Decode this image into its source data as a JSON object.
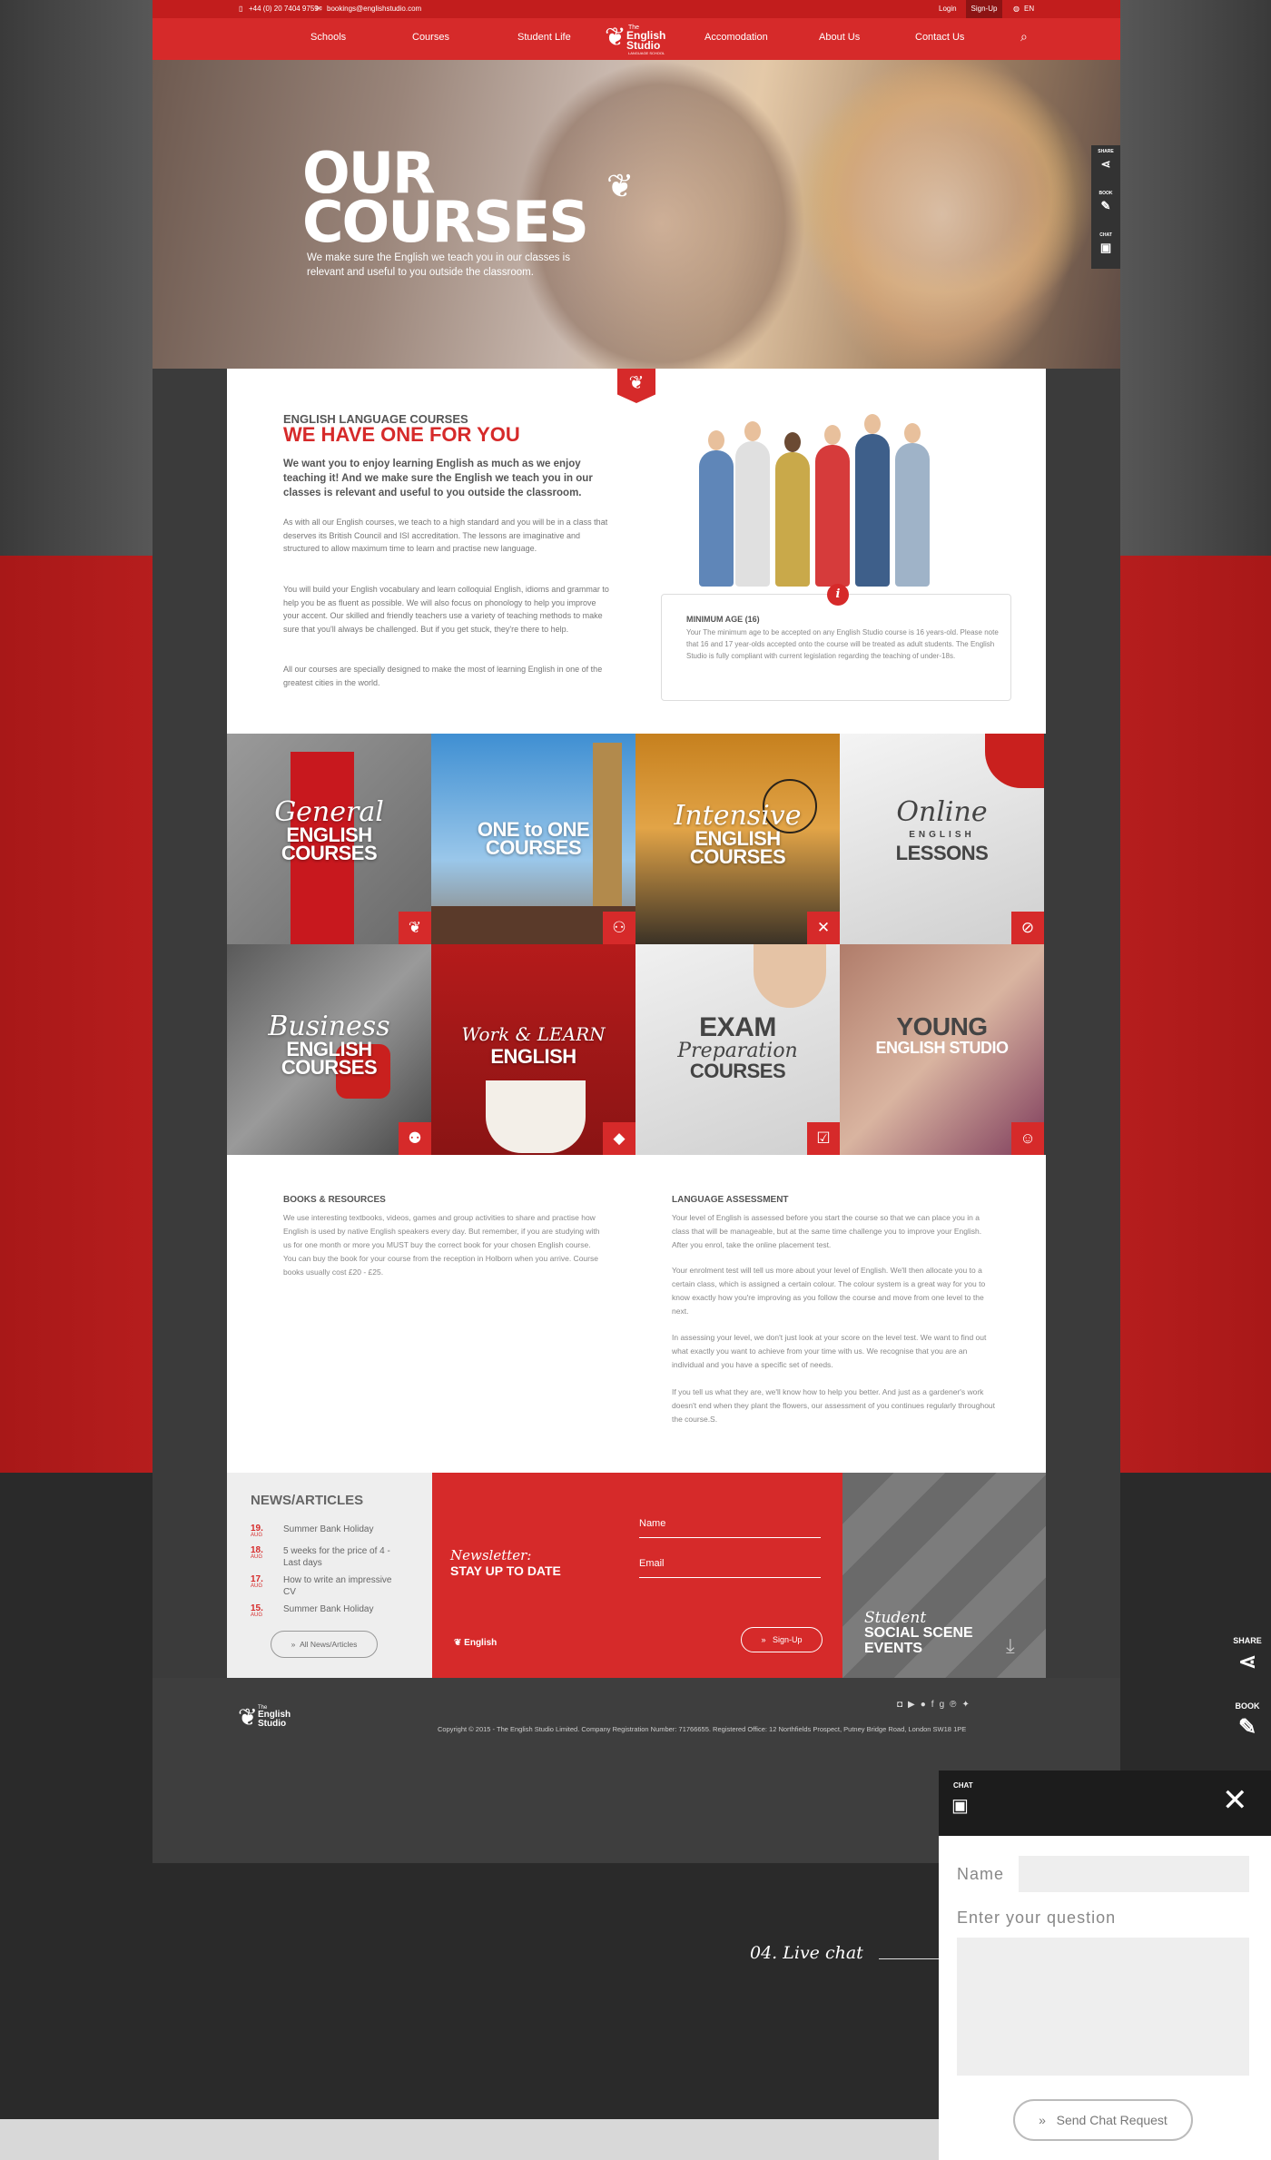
{
  "topbar": {
    "phone": "+44 (0) 20 7404 9759",
    "email": "bookings@englishstudio.com",
    "login": "Login",
    "signup": "Sign-Up",
    "language": "EN"
  },
  "brand": {
    "line1": "The",
    "line2a": "English",
    "line2b": "Studio",
    "line3": "LANGUAGE SCHOOL"
  },
  "nav": {
    "items": [
      "Schools",
      "Courses",
      "Student Life",
      "Accomodation",
      "About Us",
      "Contact Us"
    ]
  },
  "hero": {
    "title_line1": "OUR",
    "title_line2": "COURSES",
    "tagline": "We make sure the English we teach you in our classes is relevant and useful to you outside the classroom."
  },
  "sidetabs": {
    "share": "SHARE",
    "book": "BOOK",
    "chat": "CHAT"
  },
  "intro": {
    "eyebrow": "ENGLISH LANGUAGE COURSES",
    "headline": "WE HAVE ONE FOR YOU",
    "lead": "We want you to enjoy learning English as much as we enjoy teaching it! And we make sure the English we teach you in our classes is relevant and useful to you outside the classroom.",
    "paragraphs": [
      "As with all our English courses, we teach to a high standard and you will be in a class that deserves its British Council and ISI accreditation. The lessons are imaginative and structured to allow maximum time to learn and practise new language.",
      "You will build your English vocabulary and learn colloquial English, idioms and grammar to help you be as fluent as possible. We will also focus on phonology to help you improve your accent. Our skilled and friendly teachers use a variety of teaching methods to make sure that you'll always be challenged. But if you get stuck, they're there to help.",
      "All our courses are specially designed to make the most of learning English in one of the greatest cities in the world."
    ],
    "min_age_title": "MINIMUM AGE (16)",
    "min_age_body": "Your The minimum age to be accepted on any English Studio course is 16 years-old. Please note that 16 and 17 year-olds accepted onto the course will be treated as adult students. The English Studio is fully compliant with current legislation regarding the teaching of under-18s."
  },
  "courses": [
    {
      "script": "General",
      "big1": "ENGLISH",
      "big2": "COURSES"
    },
    {
      "script": "",
      "big1": "ONE to ONE",
      "big2": "COURSES"
    },
    {
      "script": "Intensive",
      "big1": "ENGLISH",
      "big2": "COURSES"
    },
    {
      "script": "Online",
      "big1": "ENGLISH",
      "big2": "LESSONS"
    },
    {
      "script": "Business",
      "big1": "ENGLISH",
      "big2": "COURSES"
    },
    {
      "script": "Work & LEARN",
      "big1": "ENGLISH",
      "big2": ""
    },
    {
      "script": "Preparation",
      "big1": "EXAM",
      "big2": "COURSES"
    },
    {
      "script": "",
      "big1": "YOUNG",
      "big2": "ENGLISH STUDIO"
    }
  ],
  "resources": {
    "books_title": "BOOKS & RESOURCES",
    "books_body": "We use interesting textbooks, videos, games and group activities to share and practise how English is used by native English speakers every day. But remember, if you are studying with us for one month or more you MUST buy the correct book for your chosen English course. You can buy the book for your course from the reception in Holborn when you arrive. Course books usually cost £20 - £25.",
    "assess_title": "LANGUAGE ASSESSMENT",
    "assess_paragraphs": [
      "Your level of English is assessed before you start the course so that we can place you in a class that will be manageable, but at the same time challenge you to improve your English. After you enrol, take the online placement test.",
      "Your enrolment test will tell us more about your level of English. We'll then allocate you to a certain class, which is assigned a certain colour. The colour system is a great way for you to know exactly how you're improving as you follow the course and move from one level to the next.",
      "In assessing your level, we don't just look at your score on the level test. We want to find out what exactly you want to achieve from your time with us. We recognise that you are an individual and you have a specific set of needs.",
      "If you tell us what they are, we'll know how to help you better. And just as a gardener's work doesn't end when they plant the flowers, our assessment of you continues regularly throughout the course.S."
    ]
  },
  "news": {
    "title": "NEWS/ARTICLES",
    "items": [
      {
        "day": "19.",
        "month": "AUG",
        "title": "Summer Bank Holiday"
      },
      {
        "day": "18.",
        "month": "AUG",
        "title": "5 weeks for the price of 4 - Last days"
      },
      {
        "day": "17.",
        "month": "AUG",
        "title": "How to write an impressive CV"
      },
      {
        "day": "15.",
        "month": "AUG",
        "title": "Summer Bank Holiday"
      }
    ],
    "all_link": "All News/Articles"
  },
  "newsletter": {
    "script": "Newsletter:",
    "bold": "STAY UP TO DATE",
    "name_label": "Name",
    "email_label": "Email",
    "signup": "Sign-Up"
  },
  "social_scene": {
    "script": "Student",
    "bold1": "SOCIAL SCENE",
    "bold2": "EVENTS"
  },
  "footer": {
    "copyright": "Copyright © 2015 - The English Studio Limited. Company Registration Number: 71766655. Registered Office: 12 Northfields Prospect, Putney Bridge Road, London SW18 1PE"
  },
  "livechat_label": "04. Live chat",
  "float_tabs": {
    "share": "SHARE",
    "book": "BOOK"
  },
  "chat": {
    "label": "CHAT",
    "name_label": "Name",
    "question_label": "Enter your question",
    "send": "Send Chat Request"
  },
  "colors": {
    "brand_red": "#d62a2a",
    "dark": "#2a2a2a"
  }
}
